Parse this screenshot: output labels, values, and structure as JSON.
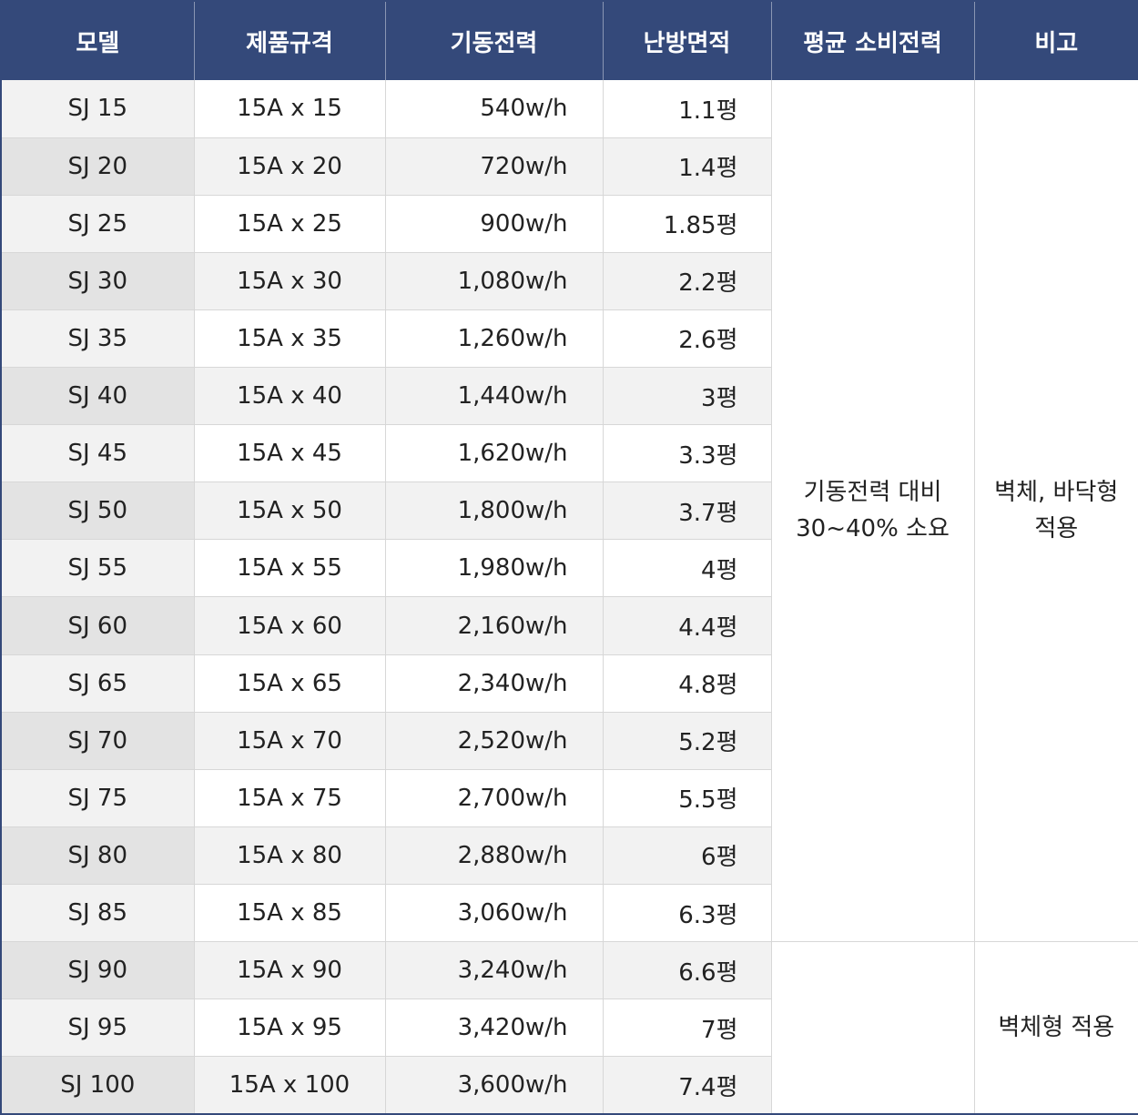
{
  "table": {
    "headers": [
      "모델",
      "제품규격",
      "기동전력",
      "난방면적",
      "평균 소비전력",
      "비고"
    ],
    "rows": [
      {
        "model": "SJ 15",
        "spec": "15A x 15",
        "power": "540w/h",
        "area": "1.1평"
      },
      {
        "model": "SJ 20",
        "spec": "15A x 20",
        "power": "720w/h",
        "area": "1.4평"
      },
      {
        "model": "SJ 25",
        "spec": "15A x 25",
        "power": "900w/h",
        "area": "1.85평"
      },
      {
        "model": "SJ 30",
        "spec": "15A x 30",
        "power": "1,080w/h",
        "area": "2.2평"
      },
      {
        "model": "SJ 35",
        "spec": "15A x 35",
        "power": "1,260w/h",
        "area": "2.6평"
      },
      {
        "model": "SJ 40",
        "spec": "15A x 40",
        "power": "1,440w/h",
        "area": "3평"
      },
      {
        "model": "SJ 45",
        "spec": "15A x 45",
        "power": "1,620w/h",
        "area": "3.3평"
      },
      {
        "model": "SJ 50",
        "spec": "15A x 50",
        "power": "1,800w/h",
        "area": "3.7평"
      },
      {
        "model": "SJ 55",
        "spec": "15A x 55",
        "power": "1,980w/h",
        "area": "4평"
      },
      {
        "model": "SJ 60",
        "spec": "15A x 60",
        "power": "2,160w/h",
        "area": "4.4평"
      },
      {
        "model": "SJ 65",
        "spec": "15A x 65",
        "power": "2,340w/h",
        "area": "4.8평"
      },
      {
        "model": "SJ 70",
        "spec": "15A x 70",
        "power": "2,520w/h",
        "area": "5.2평"
      },
      {
        "model": "SJ 75",
        "spec": "15A x 75",
        "power": "2,700w/h",
        "area": "5.5평"
      },
      {
        "model": "SJ 80",
        "spec": "15A x 80",
        "power": "2,880w/h",
        "area": "6평"
      },
      {
        "model": "SJ 85",
        "spec": "15A x 85",
        "power": "3,060w/h",
        "area": "6.3평"
      },
      {
        "model": "SJ 90",
        "spec": "15A x 90",
        "power": "3,240w/h",
        "area": "6.6평"
      },
      {
        "model": "SJ 95",
        "spec": "15A x 95",
        "power": "3,420w/h",
        "area": "7평"
      },
      {
        "model": "SJ 100",
        "spec": "15A x 100",
        "power": "3,600w/h",
        "area": "7.4평"
      }
    ],
    "avg_power_note": {
      "line1": "기동전력 대비",
      "line2": "30~40% 소요"
    },
    "remark_group1": {
      "line1": "벽체, 바닥형",
      "line2": "적용"
    },
    "remark_group2": "벽체형 적용"
  },
  "colors": {
    "header_bg": "#34497a",
    "header_text": "#ffffff",
    "border": "#d7d7d7",
    "model_cell_light": "#f2f2f2",
    "model_cell_dark": "#e3e3e3"
  }
}
